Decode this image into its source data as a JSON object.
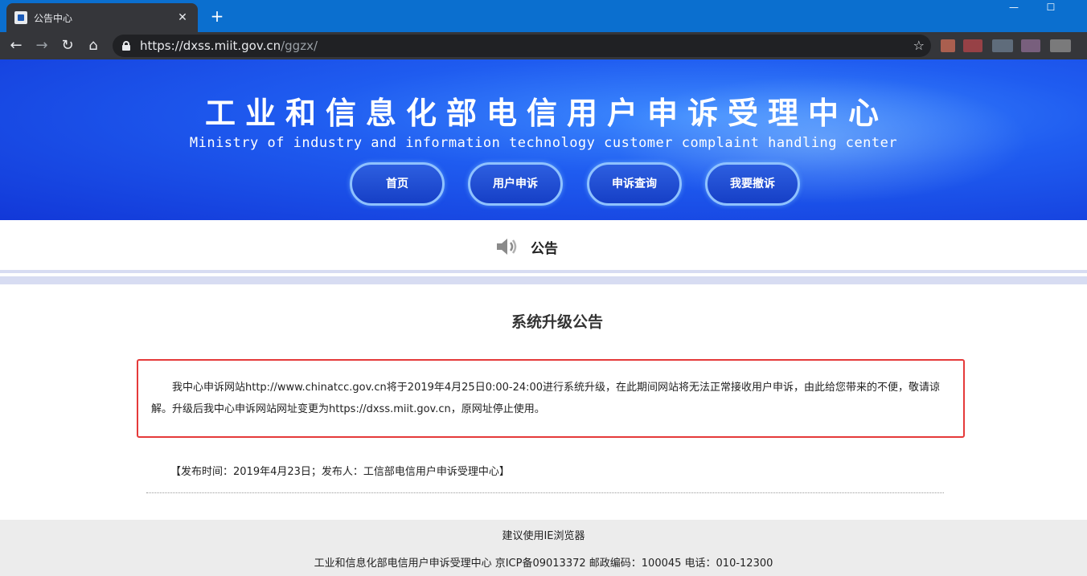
{
  "browser": {
    "tab_title": "公告中心",
    "tab_close": "✕",
    "new_tab": "+",
    "minimize": "—",
    "maximize": "☐",
    "url_host": "https://dxss.miit.gov.cn",
    "url_path": "/ggzx/",
    "back": "←",
    "forward": "→",
    "reload": "↻",
    "home": "⌂",
    "bookmark": "☆"
  },
  "header": {
    "title": "工业和信息化部电信用户申诉受理中心",
    "subtitle": "Ministry of industry and information technology customer complaint handling center"
  },
  "nav": {
    "items": [
      {
        "label": "首页"
      },
      {
        "label": "用户申诉"
      },
      {
        "label": "申诉查询"
      },
      {
        "label": "我要撤诉"
      }
    ]
  },
  "notice": {
    "section_label": "公告",
    "title": "系统升级公告",
    "body": "我中心申诉网站http://www.chinatcc.gov.cn将于2019年4月25日0:00-24:00进行系统升级，在此期间网站将无法正常接收用户申诉，由此给您带来的不便，敬请谅解。升级后我中心申诉网站网址变更为https://dxss.miit.gov.cn，原网址停止使用。",
    "publish_info": "【发布时间：2019年4月23日；发布人：工信部电信用户申诉受理中心】"
  },
  "footer": {
    "browser_tip": "建议使用IE浏览器",
    "info": "工业和信息化部电信用户申诉受理中心 京ICP备09013372 邮政编码：100045 电话：010-12300"
  },
  "colors": {
    "tabbar": "#0b6fcf",
    "toolbar": "#35363a",
    "banner": "#1f5cf0",
    "highlight_border": "#e53a3a",
    "stripe": "#d7dcf2",
    "footer": "#ececec"
  }
}
